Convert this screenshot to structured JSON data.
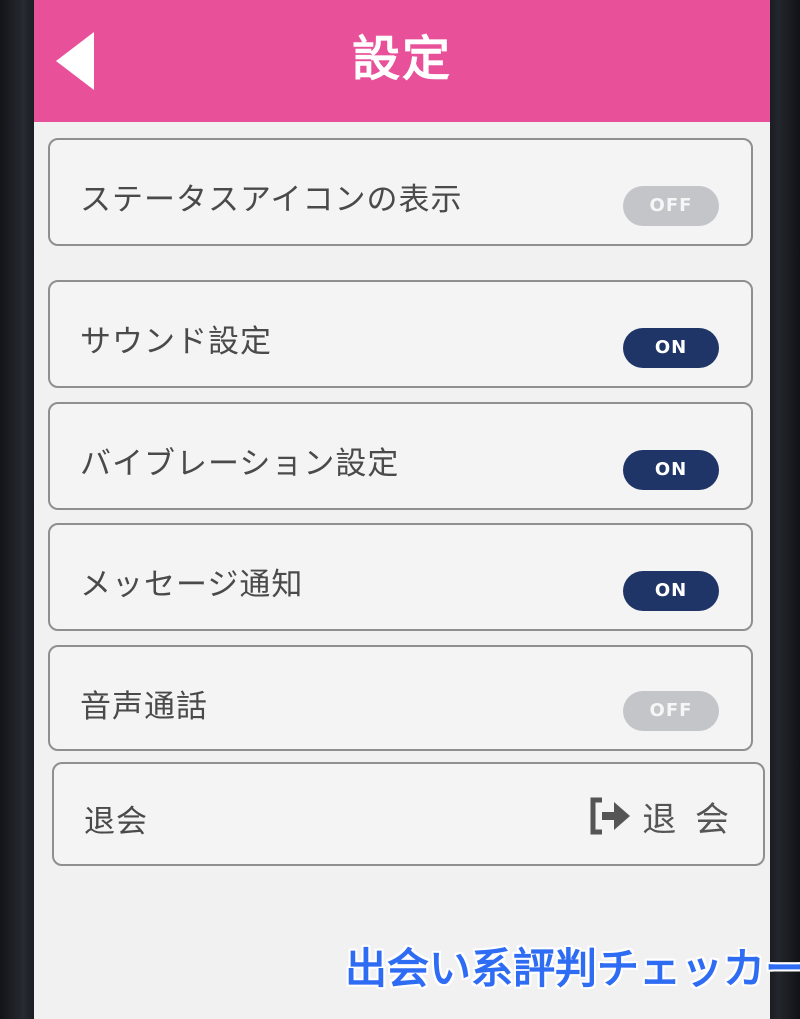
{
  "header": {
    "title": "設定",
    "back_icon": "back-arrow-icon",
    "color": "#e8509a"
  },
  "settings": [
    {
      "label": "ステータスアイコンの表示",
      "state": "OFF",
      "enabled": false
    },
    {
      "label": "サウンド設定",
      "state": "ON",
      "enabled": true
    },
    {
      "label": "バイブレーション設定",
      "state": "ON",
      "enabled": true
    },
    {
      "label": "メッセージ通知",
      "state": "ON",
      "enabled": true
    },
    {
      "label": "音声通話",
      "state": "OFF",
      "enabled": false
    }
  ],
  "withdraw": {
    "label": "退会",
    "action_label": "退 会",
    "action_icon": "sign-out-icon"
  },
  "watermark": "出会い系評判チェッカー",
  "colors": {
    "toggle_on": "#1f3568",
    "toggle_off": "#c3c5c9",
    "watermark": "#2f6cf4"
  }
}
